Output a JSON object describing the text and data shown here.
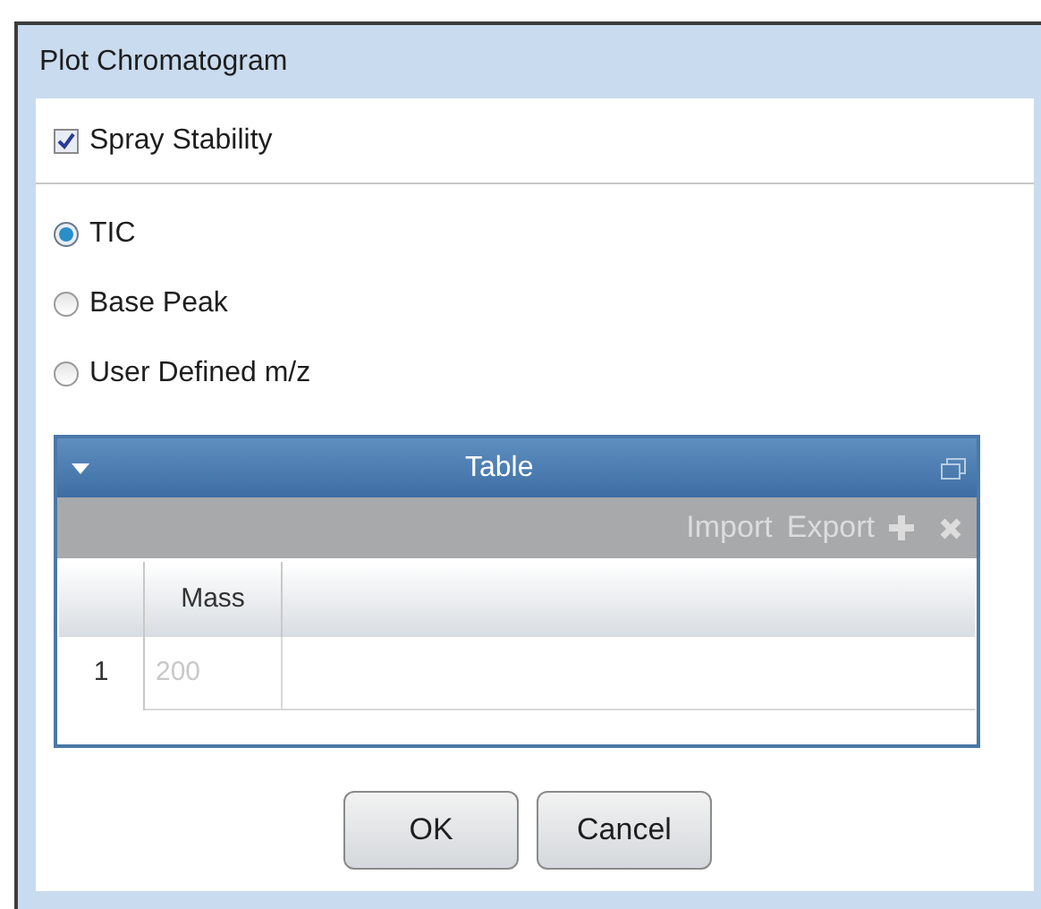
{
  "window": {
    "title": "Plot Chromatogram"
  },
  "spray_stability": {
    "label": "Spray Stability",
    "checked": true
  },
  "options": [
    {
      "label": "TIC",
      "selected": true
    },
    {
      "label": "Base Peak",
      "selected": false
    },
    {
      "label": "User Defined m/z",
      "selected": false
    }
  ],
  "table": {
    "title": "Table",
    "toolbar": [
      "Import",
      "Export"
    ],
    "columns": [
      "Mass"
    ],
    "rows": [
      {
        "index": "1",
        "mass": "200"
      }
    ]
  },
  "buttons": [
    "OK",
    "Cancel"
  ]
}
